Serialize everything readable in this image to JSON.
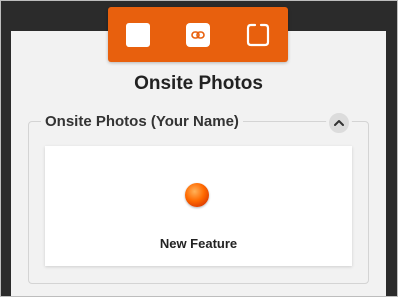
{
  "toolbar": {
    "bg_color": "#e8600d",
    "buttons": [
      {
        "icon": "square-icon"
      },
      {
        "icon": "link-icon"
      },
      {
        "icon": "corners-icon"
      }
    ]
  },
  "page": {
    "title": "Onsite Photos"
  },
  "group": {
    "label": "Onsite Photos (Your Name)",
    "collapse_icon": "chevron-up-icon"
  },
  "card": {
    "icon": "orange-dot-icon",
    "label": "New Feature"
  }
}
